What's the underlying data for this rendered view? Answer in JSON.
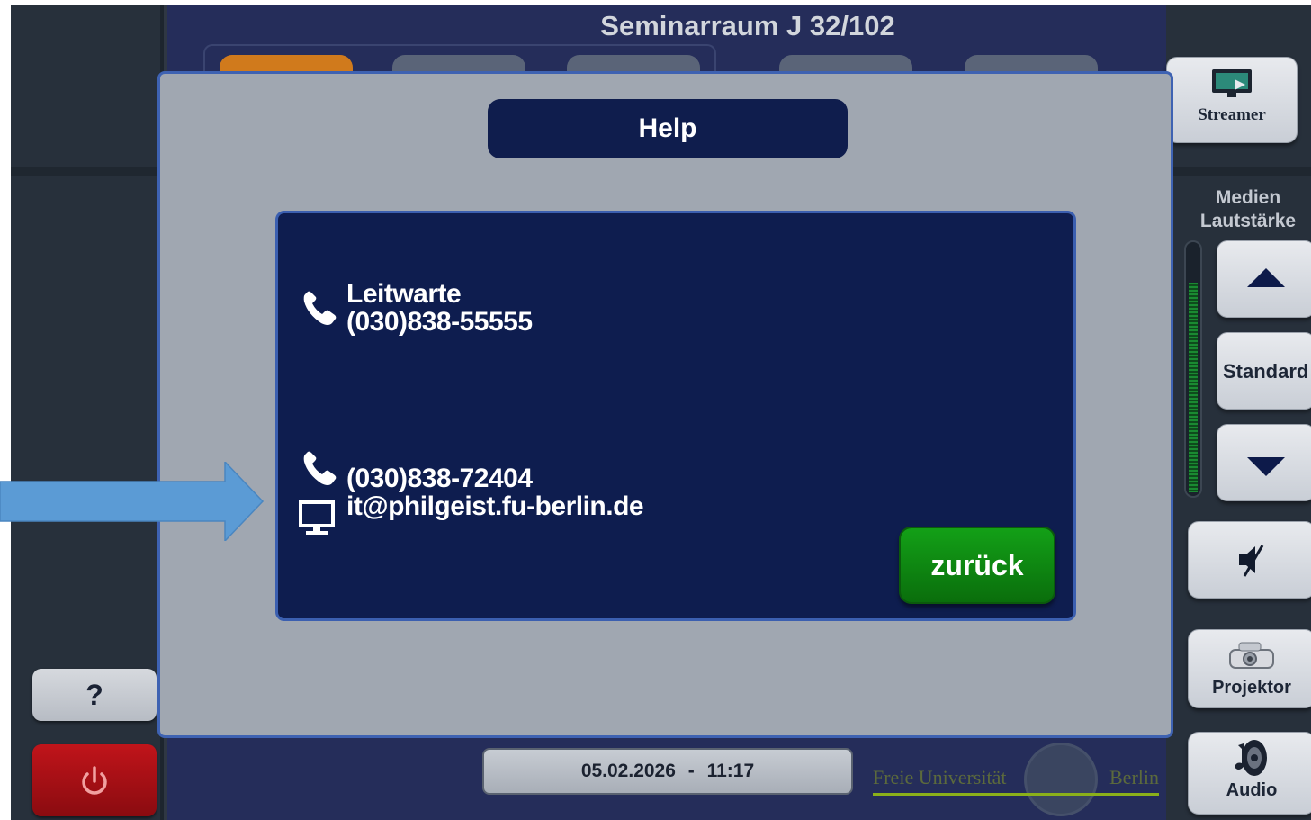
{
  "room_title": "Seminarraum J 32/102",
  "right_panel": {
    "streamer_label": "Streamer",
    "volume_title_line1": "Medien",
    "volume_title_line2": "Lautstärke",
    "standard_label": "Standard",
    "projector_label": "Projektor",
    "audio_label": "Audio"
  },
  "left_panel": {
    "help_label": "?"
  },
  "footer": {
    "date": "05.02.2026",
    "separator": "-",
    "time": "11:17",
    "logo_left": "Freie Universität",
    "logo_right": "Berlin"
  },
  "dialog": {
    "title": "Help",
    "contact1_name": "Leitwarte",
    "contact1_phone": "(030)838-55555",
    "contact2_phone": "(030)838-72404",
    "contact2_email": "it@philgeist.fu-berlin.de",
    "back_label": "zurück"
  },
  "colors": {
    "dialog_bg": "#a0a7b1",
    "panel_bg": "#0e1d4f",
    "back_button": "#13a017",
    "arrow": "#5b9bd5",
    "power_button": "#c0141a"
  },
  "volume_level": 0.85
}
